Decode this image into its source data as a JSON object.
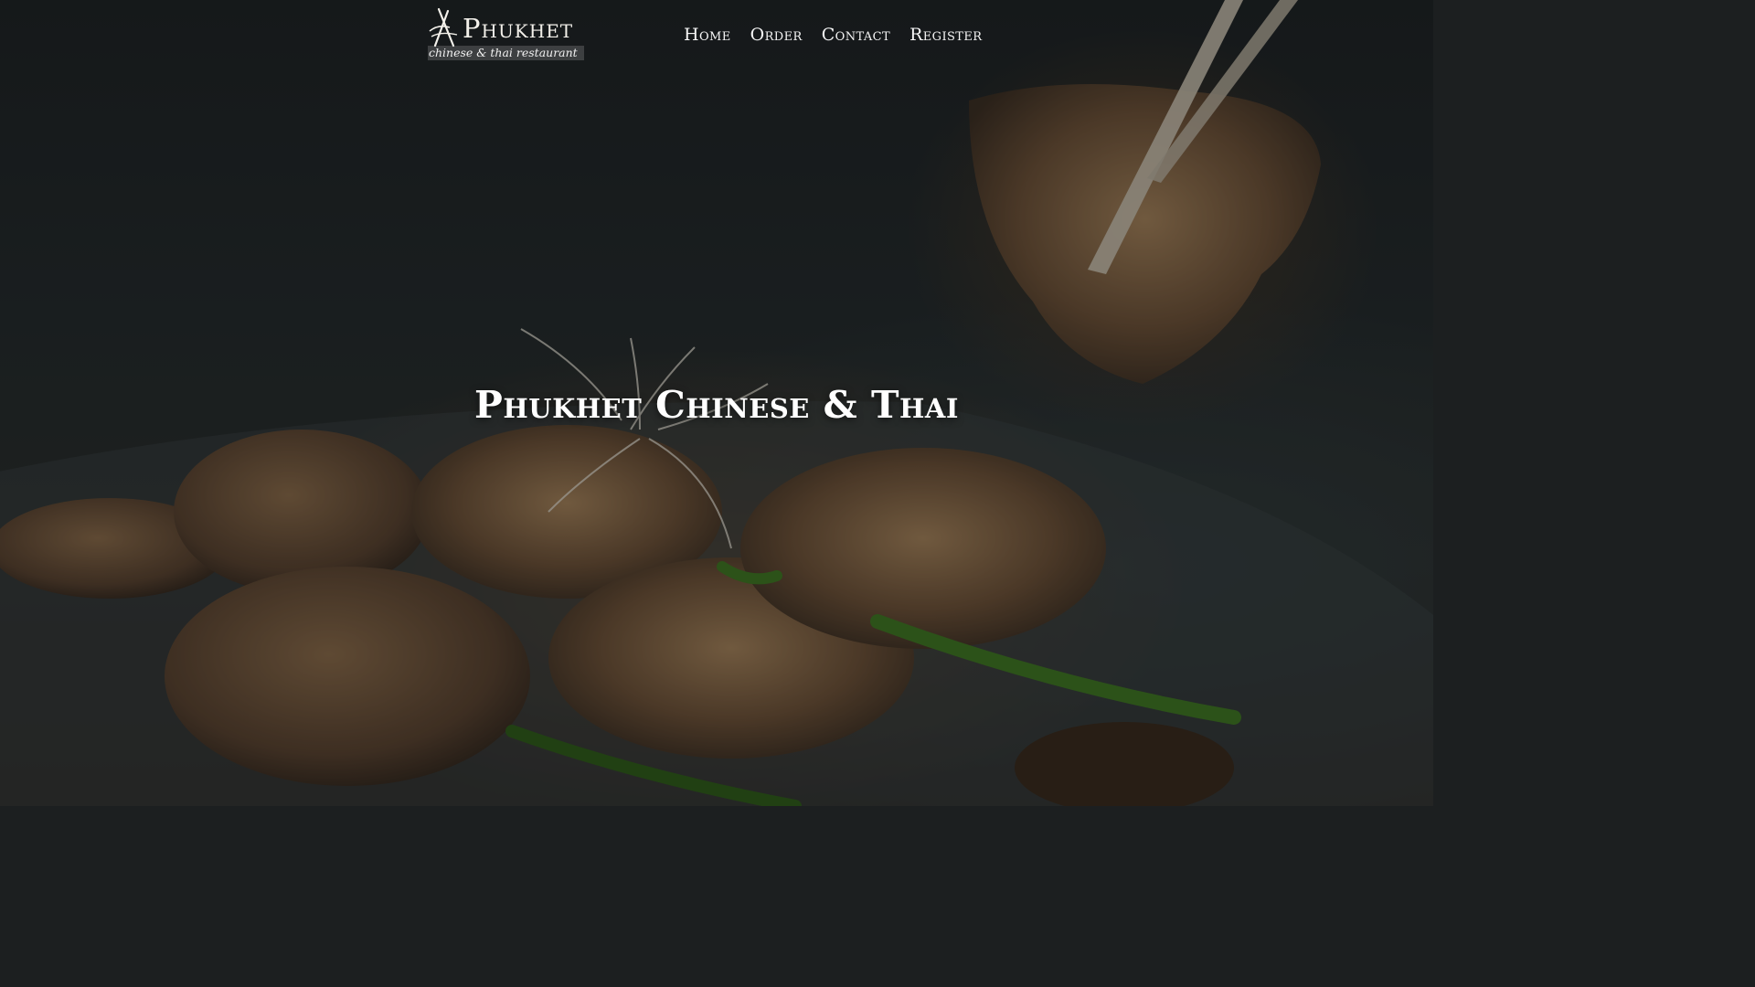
{
  "logo": {
    "name": "Phukhet",
    "tagline": "chinese & thai restaurant",
    "icon": "chopsticks-icon"
  },
  "nav": {
    "items": [
      {
        "label": "Home"
      },
      {
        "label": "Order"
      },
      {
        "label": "Contact"
      },
      {
        "label": "Register"
      }
    ]
  },
  "hero": {
    "title": "Phukhet Chinese & Thai",
    "background": "food-photo-crispy-fish-with-chopsticks"
  },
  "colors": {
    "text": "#ffffff",
    "background": "#1c1f20"
  }
}
